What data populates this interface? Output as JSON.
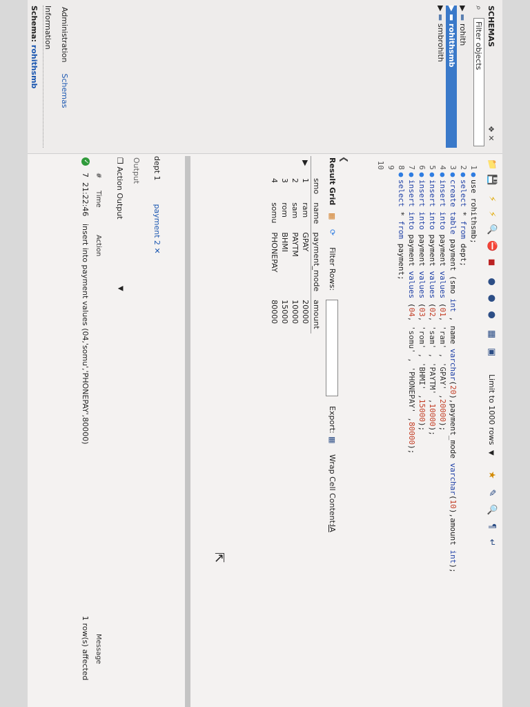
{
  "sidebar": {
    "title": "SCHEMAS",
    "tools": "❖ ✕",
    "filter_placeholder": "Filter objects",
    "schemas": [
      {
        "name": "rohith",
        "selected": false
      },
      {
        "name": "rohithsmb",
        "selected": true
      },
      {
        "name": "smbrohith",
        "selected": false
      }
    ],
    "tab_admin": "Administration",
    "tab_schemas": "Schemas",
    "info_label": "Information",
    "schema_label": "Schema:",
    "schema_value": "rohithsmb"
  },
  "editor": {
    "limit_label": "Limit to 1000 rows",
    "lines": [
      {
        "n": "1",
        "code": [
          {
            "t": "use rohithsmb;",
            "c": "plain"
          }
        ]
      },
      {
        "n": "2",
        "code": [
          {
            "t": "select ",
            "c": "kw"
          },
          {
            "t": "* ",
            "c": "plain"
          },
          {
            "t": "from ",
            "c": "kw"
          },
          {
            "t": "dept;",
            "c": "plain"
          }
        ]
      },
      {
        "n": "3",
        "code": [
          {
            "t": "create table ",
            "c": "kw"
          },
          {
            "t": "payment (smo ",
            "c": "plain"
          },
          {
            "t": "int",
            "c": "kw"
          },
          {
            "t": " , name ",
            "c": "plain"
          },
          {
            "t": "varchar",
            "c": "kw"
          },
          {
            "t": "(",
            "c": "plain"
          },
          {
            "t": "20",
            "c": "num"
          },
          {
            "t": "),payment_mode ",
            "c": "plain"
          },
          {
            "t": "varchar",
            "c": "kw"
          },
          {
            "t": "(",
            "c": "plain"
          },
          {
            "t": "10",
            "c": "num"
          },
          {
            "t": "),amount ",
            "c": "plain"
          },
          {
            "t": "int",
            "c": "kw"
          },
          {
            "t": ");",
            "c": "plain"
          }
        ]
      },
      {
        "n": "4",
        "code": [
          {
            "t": "insert into ",
            "c": "kw"
          },
          {
            "t": "payment ",
            "c": "plain"
          },
          {
            "t": "values ",
            "c": "kw"
          },
          {
            "t": "(",
            "c": "plain"
          },
          {
            "t": "01",
            "c": "num"
          },
          {
            "t": ", 'ram' , 'GPAY' ,",
            "c": "str"
          },
          {
            "t": "20000",
            "c": "num"
          },
          {
            "t": ");",
            "c": "plain"
          }
        ]
      },
      {
        "n": "5",
        "code": [
          {
            "t": "insert into ",
            "c": "kw"
          },
          {
            "t": "payment ",
            "c": "plain"
          },
          {
            "t": "values ",
            "c": "kw"
          },
          {
            "t": "(",
            "c": "plain"
          },
          {
            "t": "02",
            "c": "num"
          },
          {
            "t": ", 'sam' , 'PAYTM' ,",
            "c": "str"
          },
          {
            "t": "10000",
            "c": "num"
          },
          {
            "t": ");",
            "c": "plain"
          }
        ]
      },
      {
        "n": "6",
        "code": [
          {
            "t": "insert into ",
            "c": "kw"
          },
          {
            "t": "payment ",
            "c": "plain"
          },
          {
            "t": "values ",
            "c": "kw"
          },
          {
            "t": "(",
            "c": "plain"
          },
          {
            "t": "03",
            "c": "num"
          },
          {
            "t": ", 'rom' , 'BHMI' ,",
            "c": "str"
          },
          {
            "t": "15000",
            "c": "num"
          },
          {
            "t": ");",
            "c": "plain"
          }
        ]
      },
      {
        "n": "7",
        "code": [
          {
            "t": "insert into ",
            "c": "kw"
          },
          {
            "t": "payment ",
            "c": "plain"
          },
          {
            "t": "values ",
            "c": "kw"
          },
          {
            "t": "(",
            "c": "plain"
          },
          {
            "t": "04",
            "c": "num"
          },
          {
            "t": ", 'somu' , 'PHONEPAY' ,",
            "c": "str"
          },
          {
            "t": "80000",
            "c": "num"
          },
          {
            "t": ");",
            "c": "plain"
          }
        ]
      },
      {
        "n": "8",
        "code": [
          {
            "t": "select ",
            "c": "kw"
          },
          {
            "t": "* ",
            "c": "plain"
          },
          {
            "t": "from ",
            "c": "kw"
          },
          {
            "t": "payment;",
            "c": "plain"
          }
        ]
      },
      {
        "n": "9",
        "code": []
      },
      {
        "n": "10",
        "code": []
      }
    ]
  },
  "result": {
    "tab_label": "Result Grid",
    "filter_label": "Filter Rows:",
    "export_label": "Export:",
    "wrap_label": "Wrap Cell Content:",
    "columns": [
      "smo",
      "name",
      "payment_mode",
      "amount"
    ],
    "rows": [
      [
        "1",
        "ram",
        "GPAY",
        "20000"
      ],
      [
        "2",
        "sam",
        "PAYTM",
        "10000"
      ],
      [
        "3",
        "rom",
        "BHMI",
        "15000"
      ],
      [
        "4",
        "somu",
        "PHONEPAY",
        "80000"
      ]
    ]
  },
  "bottom_tabs": {
    "tab1": "dept 1",
    "tab2": "payment 2 ✕"
  },
  "output": {
    "label": "Output",
    "action_output": "Action Output",
    "col_hash": "#",
    "col_time": "Time",
    "col_action": "Action",
    "col_message": "Message",
    "row_num": "7",
    "row_time": "21:22:46",
    "row_action": "insert into payment values (04,'somu','PHONEPAY',80000)",
    "row_message": "1 row(s) affected"
  },
  "colors": {
    "accent": "#3a79c9",
    "ok": "#2f9a3a"
  }
}
